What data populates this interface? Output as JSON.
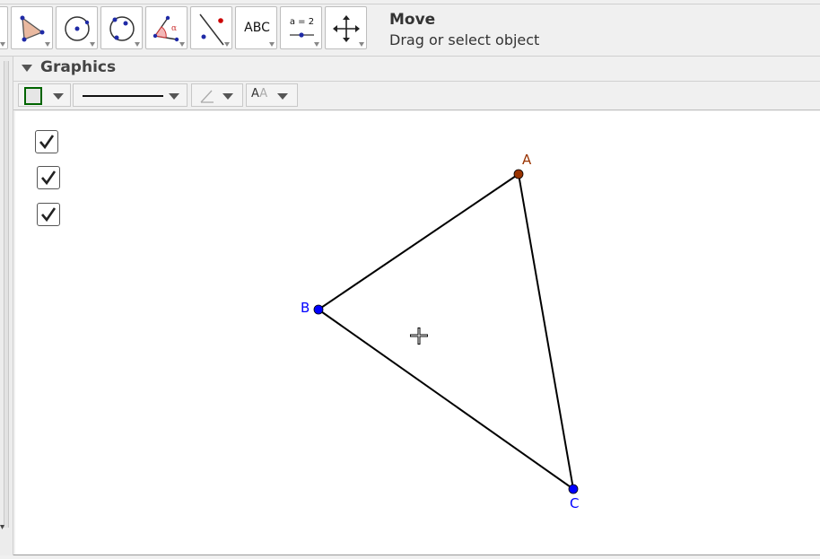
{
  "toolbar": {
    "tools": [
      {
        "name": "point-tool-icon",
        "selected": false
      },
      {
        "name": "polygon-tool-icon",
        "selected": false
      },
      {
        "name": "circle-center-point-tool-icon",
        "selected": false
      },
      {
        "name": "circle-three-points-tool-icon",
        "selected": false
      },
      {
        "name": "angle-tool-icon",
        "selected": false
      },
      {
        "name": "reflect-tool-icon",
        "selected": false
      },
      {
        "name": "text-tool-icon",
        "label": "ABC",
        "selected": false
      },
      {
        "name": "slider-tool-icon",
        "label": "a = 2",
        "selected": false
      },
      {
        "name": "move-graphics-view-tool-icon",
        "selected": false
      }
    ],
    "help_title": "Move",
    "help_text": "Drag or select object"
  },
  "graphics": {
    "title": "Graphics"
  },
  "construction": {
    "points": {
      "A": {
        "label": "A",
        "color": "#993300"
      },
      "B": {
        "label": "B",
        "color": "#0000ff"
      },
      "C": {
        "label": "C",
        "color": "#0000ff"
      }
    },
    "segment_color": "#000000"
  },
  "colors": {
    "accent_green": "#006400",
    "point_blue": "#0000ff",
    "point_brown": "#993300"
  }
}
